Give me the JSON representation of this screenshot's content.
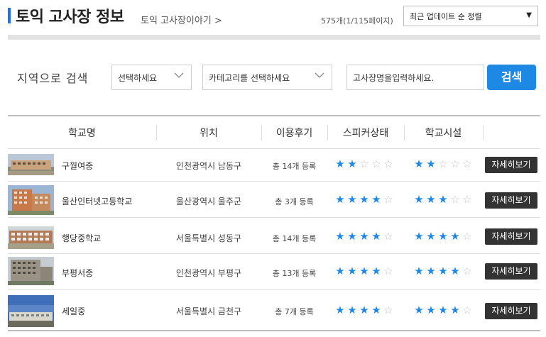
{
  "header": {
    "title": "토익 고사장 정보",
    "subtitle": "토익 고사장이야기 >",
    "page_count": "575개(1/115페이지)",
    "sort": {
      "selected": "최근 업데이트 순 정렬",
      "arrow": "▼"
    }
  },
  "search": {
    "label": "지역으로 검색",
    "region_placeholder": "선택하세요",
    "category_placeholder": "카테고리를 선택하세요",
    "name_placeholder": "고사장명을입력하세요.",
    "button": "검색"
  },
  "table": {
    "headers": [
      "학교명",
      "위치",
      "이용후기",
      "스피커상태",
      "학교시설"
    ],
    "detail_label": "자세히보기",
    "star_colors": {
      "on": "#1e88e5",
      "off": "#c4c4c4"
    },
    "rows": [
      {
        "name": "구월여중",
        "location": "인천광역시 남동구",
        "reviews": "총 14개 등록",
        "speaker": 2,
        "facility": 2
      },
      {
        "name": "울산인터넷고등학교",
        "location": "울산광역시 울주군",
        "reviews": "총 3개 등록",
        "speaker": 4,
        "facility": 3
      },
      {
        "name": "행당중학교",
        "location": "서울특별시 성동구",
        "reviews": "총 14개 등록",
        "speaker": 4,
        "facility": 4
      },
      {
        "name": "부평서중",
        "location": "인천광역시 부평구",
        "reviews": "총 13개 등록",
        "speaker": 4,
        "facility": 4
      },
      {
        "name": "세일중",
        "location": "서울특별시 금천구",
        "reviews": "총 7개 등록",
        "speaker": 4,
        "facility": 4
      }
    ]
  }
}
